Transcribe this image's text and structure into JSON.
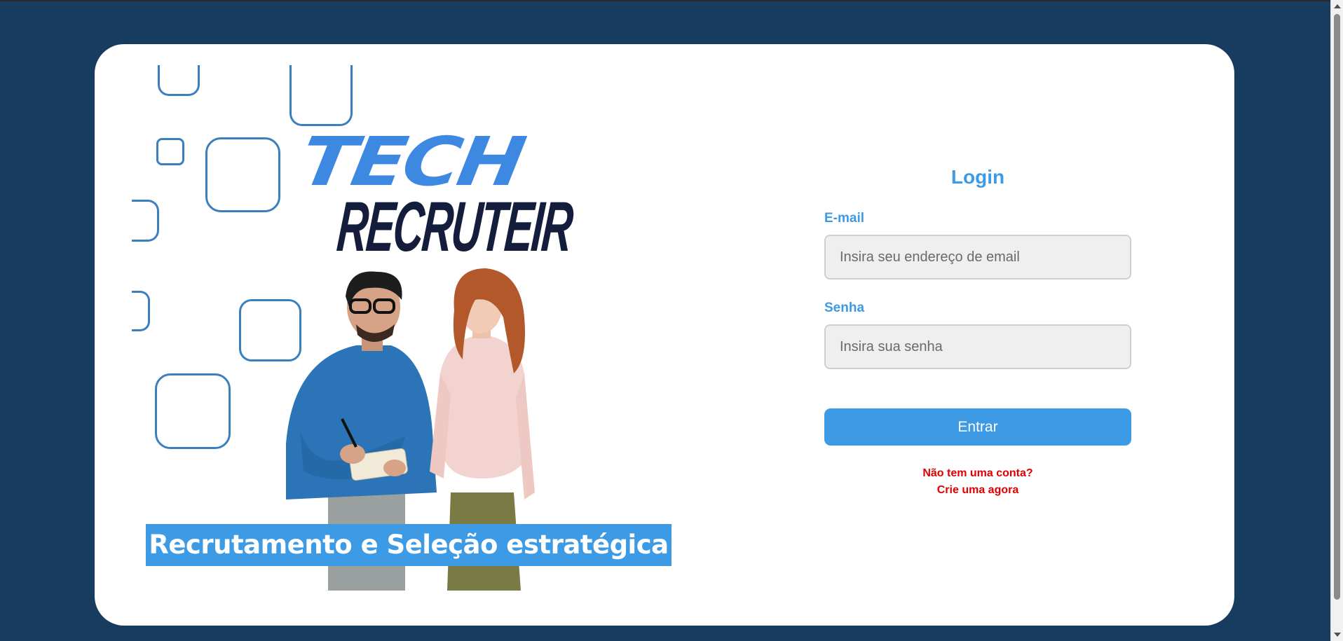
{
  "brand": {
    "logo_line1": "TECH",
    "logo_line2": "RECRUTEIR",
    "tagline": "Recrutamento e Seleção estratégica"
  },
  "login": {
    "title": "Login",
    "email_label": "E-mail",
    "email_placeholder": "Insira seu endereço de email",
    "email_value": "",
    "password_label": "Senha",
    "password_placeholder": "Insira sua senha",
    "password_value": "",
    "submit_label": "Entrar",
    "signup_prompt": "Não tem uma conta?",
    "signup_link": "Crie uma agora"
  },
  "colors": {
    "page_background": "#183c60",
    "accent": "#3d9be6",
    "link": "#e00000"
  }
}
